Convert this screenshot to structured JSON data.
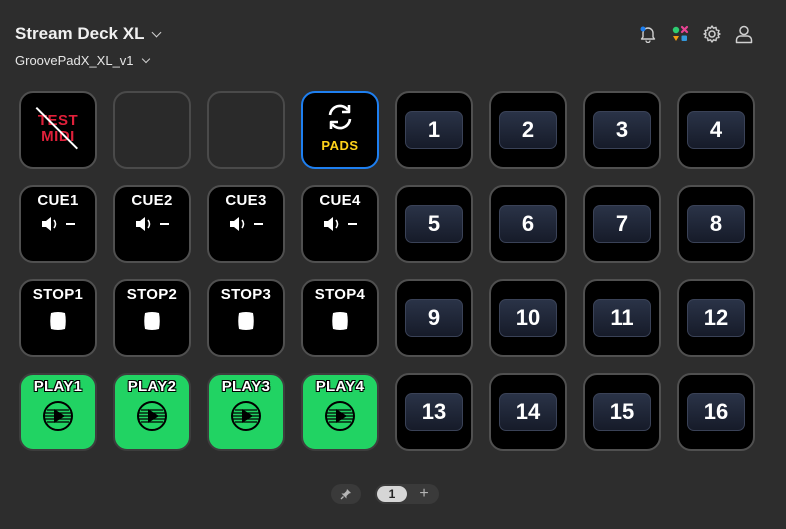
{
  "header": {
    "device_name": "Stream Deck XL",
    "profile_name": "GroovePadX_XL_v1"
  },
  "toolbar": {
    "icons": [
      "bell-icon",
      "marketplace-icon",
      "gear-icon",
      "user-icon"
    ]
  },
  "keys": {
    "test_midi": [
      "TEST",
      "MIDI"
    ],
    "pads_label": "PADS",
    "cue": [
      "CUE1",
      "CUE2",
      "CUE3",
      "CUE4"
    ],
    "stop": [
      "STOP1",
      "STOP2",
      "STOP3",
      "STOP4"
    ],
    "play": [
      "PLAY1",
      "PLAY2",
      "PLAY3",
      "PLAY4"
    ],
    "pads": [
      "1",
      "2",
      "3",
      "4",
      "5",
      "6",
      "7",
      "8",
      "9",
      "10",
      "11",
      "12",
      "13",
      "14",
      "15",
      "16"
    ]
  },
  "colors": {
    "background": "#2d2d2d",
    "play_green": "#21d363",
    "test_midi_red": "#e0203a",
    "pads_yellow": "#ffd31a",
    "selected_border": "#1e7ff0"
  },
  "pager": {
    "current_page": "1",
    "add_label": "+"
  }
}
